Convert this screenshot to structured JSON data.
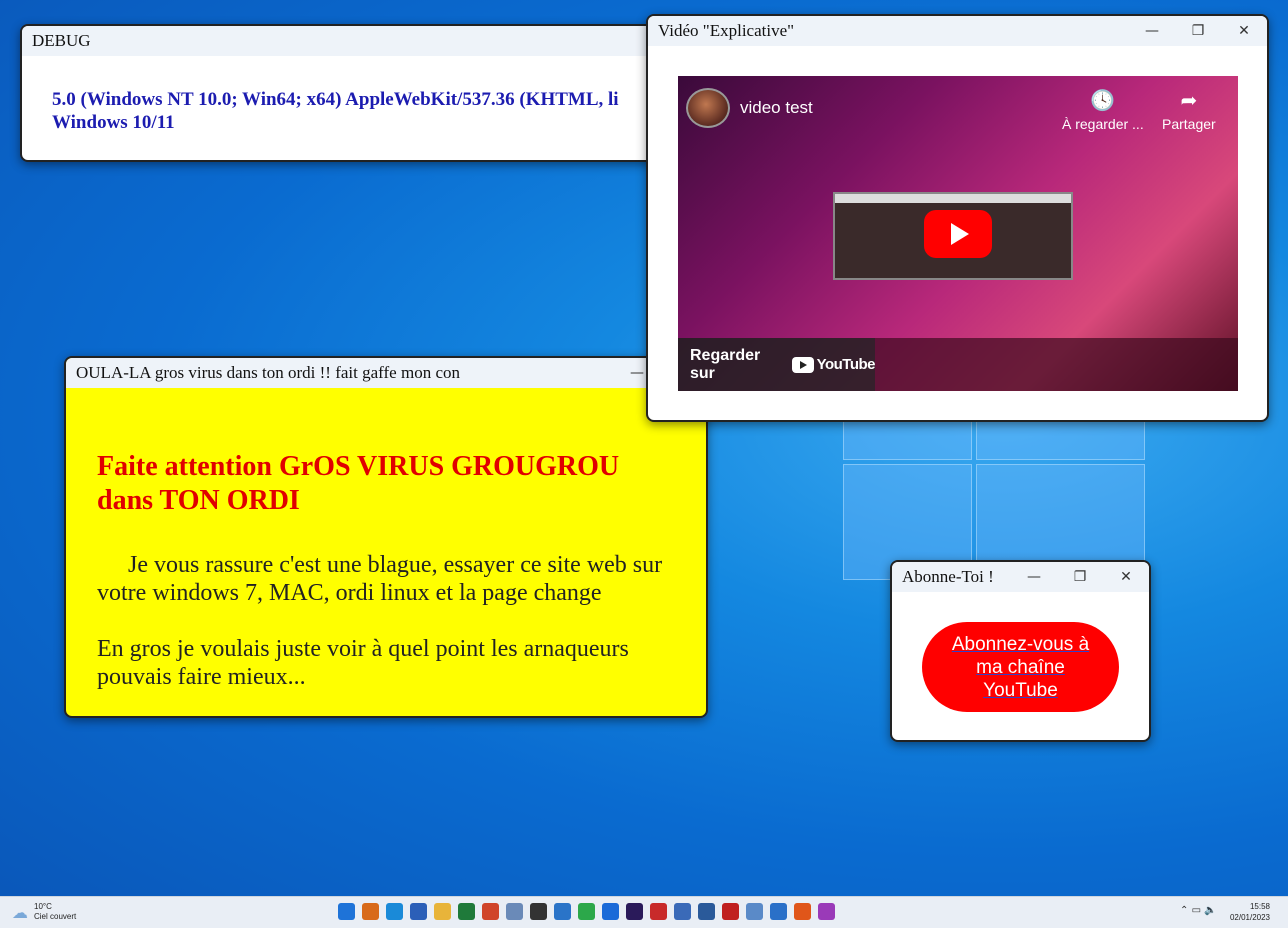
{
  "debug_window": {
    "title": "DEBUG",
    "line1": "5.0 (Windows NT 10.0; Win64; x64) AppleWebKit/537.36 (KHTML, li",
    "line2": "Windows 10/11"
  },
  "virus_window": {
    "title": "OULA-LA gros virus dans ton ordi !! fait gaffe mon con",
    "heading": "Faite attention GrOS VIRUS GROUGROU dans TON ORDI",
    "paragraph1": "Je vous rassure c'est une blague, essayer ce site web sur votre windows 7, MAC, ordi linux et la page change",
    "paragraph2": "En gros je voulais juste voir à quel point les arnaqueurs pouvais faire mieux..."
  },
  "video_window": {
    "title": "Vidéo \"Explicative\"",
    "video_title": "video test",
    "watch_later": "À regarder ...",
    "share": "Partager",
    "watch_on": "Regarder sur",
    "youtube": "YouTube"
  },
  "abonne_window": {
    "title": "Abonne-Toi !",
    "button_label": "Abonnez-vous à ma chaîne YouTube"
  },
  "window_controls": {
    "minimize": "—",
    "restore": "❐",
    "close": "✕"
  },
  "taskbar": {
    "temperature": "10°C",
    "weather": "Ciel couvert",
    "time": "15:58",
    "date": "02/01/2023",
    "app_colors": [
      "#1e73d8",
      "#d86a1a",
      "#1a8ad8",
      "#2b5fb8",
      "#e8b43a",
      "#1f7a3a",
      "#d0452a",
      "#6a8ab8",
      "#333333",
      "#2a74c8",
      "#2ca84a",
      "#1a6ad8",
      "#2a1a5a",
      "#c82a2a",
      "#3a6ab8",
      "#2a5a9a",
      "#c02020",
      "#5a8ac8",
      "#2a70c8",
      "#e0561a",
      "#9a3ab8"
    ]
  }
}
